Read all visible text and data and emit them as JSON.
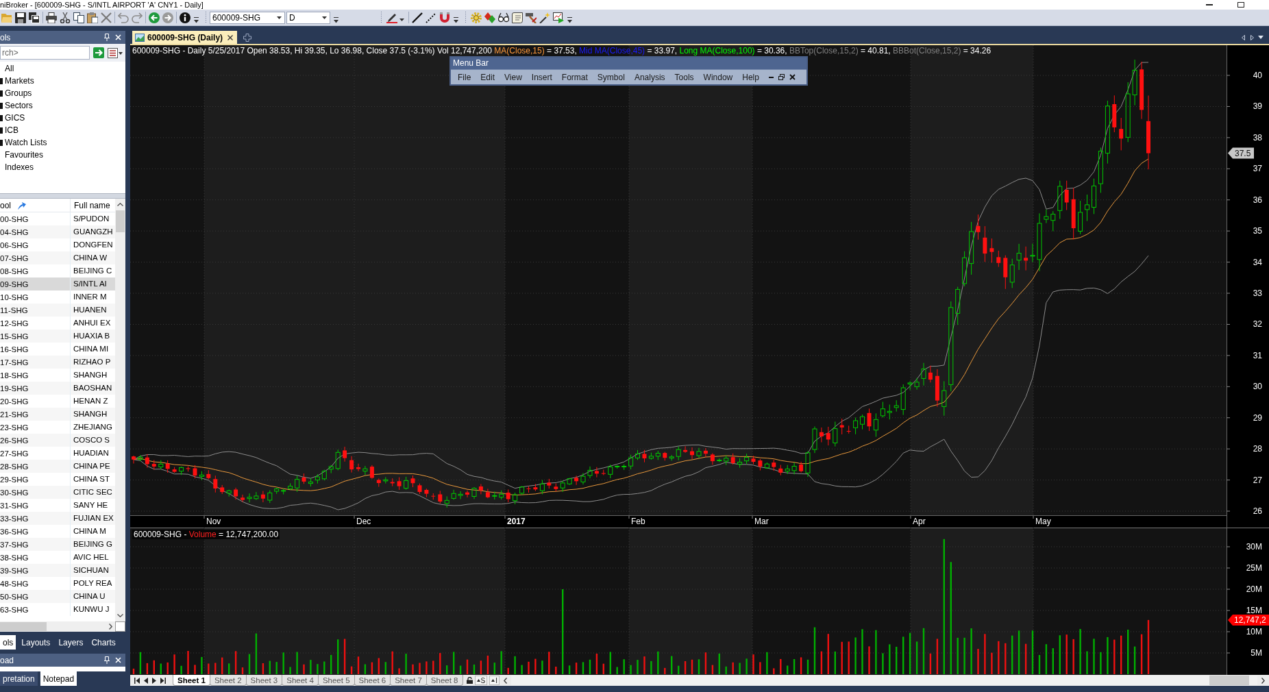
{
  "window": {
    "title": "niBroker - [600009-SHG - S/INTL AIRPORT 'A' CNY1 - Daily]"
  },
  "toolbar": {
    "symbol": "600009-SHG",
    "interval": "D"
  },
  "tools_panel": {
    "title": "ols",
    "search": {
      "placeholder": "rch>"
    },
    "tree": [
      {
        "label": "All",
        "has_expander": false
      },
      {
        "label": "Markets",
        "has_expander": true
      },
      {
        "label": "Groups",
        "has_expander": true
      },
      {
        "label": "Sectors",
        "has_expander": true
      },
      {
        "label": "GICS",
        "has_expander": true
      },
      {
        "label": "ICB",
        "has_expander": true
      },
      {
        "label": "Watch Lists",
        "has_expander": true
      },
      {
        "label": "Favourites",
        "has_expander": false
      },
      {
        "label": "Indexes",
        "has_expander": false
      }
    ]
  },
  "symbol_list": {
    "columns": [
      "ool",
      "Full name"
    ],
    "rows": [
      {
        "symbol": "00-SHG",
        "name": "S/PUDON",
        "selected": false
      },
      {
        "symbol": "04-SHG",
        "name": "GUANGZH",
        "selected": false
      },
      {
        "symbol": "06-SHG",
        "name": "DONGFEN",
        "selected": false
      },
      {
        "symbol": "07-SHG",
        "name": "CHINA W",
        "selected": false
      },
      {
        "symbol": "08-SHG",
        "name": "BEIJING C",
        "selected": false
      },
      {
        "symbol": "09-SHG",
        "name": "S/INTL AI",
        "selected": true
      },
      {
        "symbol": "10-SHG",
        "name": "INNER M",
        "selected": false
      },
      {
        "symbol": "11-SHG",
        "name": "HUANEN",
        "selected": false
      },
      {
        "symbol": "12-SHG",
        "name": "ANHUI EX",
        "selected": false
      },
      {
        "symbol": "15-SHG",
        "name": "HUAXIA B",
        "selected": false
      },
      {
        "symbol": "16-SHG",
        "name": "CHINA MI",
        "selected": false
      },
      {
        "symbol": "17-SHG",
        "name": "RIZHAO P",
        "selected": false
      },
      {
        "symbol": "18-SHG",
        "name": "SHANGH",
        "selected": false
      },
      {
        "symbol": "19-SHG",
        "name": "BAOSHAN",
        "selected": false
      },
      {
        "symbol": "20-SHG",
        "name": "HENAN Z",
        "selected": false
      },
      {
        "symbol": "21-SHG",
        "name": "SHANGH",
        "selected": false
      },
      {
        "symbol": "23-SHG",
        "name": "ZHEJIANG",
        "selected": false
      },
      {
        "symbol": "26-SHG",
        "name": "COSCO S",
        "selected": false
      },
      {
        "symbol": "27-SHG",
        "name": "HUADIAN",
        "selected": false
      },
      {
        "symbol": "28-SHG",
        "name": "CHINA PE",
        "selected": false
      },
      {
        "symbol": "29-SHG",
        "name": "CHINA ST",
        "selected": false
      },
      {
        "symbol": "30-SHG",
        "name": "CITIC SEC",
        "selected": false
      },
      {
        "symbol": "31-SHG",
        "name": "SANY HE",
        "selected": false
      },
      {
        "symbol": "33-SHG",
        "name": "FUJIAN EX",
        "selected": false
      },
      {
        "symbol": "36-SHG",
        "name": "CHINA M",
        "selected": false
      },
      {
        "symbol": "37-SHG",
        "name": "BEIJING G",
        "selected": false
      },
      {
        "symbol": "38-SHG",
        "name": "AVIC HEL",
        "selected": false
      },
      {
        "symbol": "39-SHG",
        "name": "SICHUAN",
        "selected": false
      },
      {
        "symbol": "48-SHG",
        "name": "POLY REA",
        "selected": false
      },
      {
        "symbol": "50-SHG",
        "name": "CHINA U",
        "selected": false
      },
      {
        "symbol": "63-SHG",
        "name": "KUNWU J",
        "selected": false
      }
    ]
  },
  "panel_tabs": [
    {
      "label": "ols",
      "selected": true
    },
    {
      "label": "Layouts",
      "selected": false
    },
    {
      "label": "Layers",
      "selected": false
    },
    {
      "label": "Charts",
      "selected": false
    }
  ],
  "notepad_panel": {
    "title": "oad",
    "tabs": [
      {
        "label": "pretation",
        "selected": false
      },
      {
        "label": "Notepad",
        "selected": true
      }
    ]
  },
  "chart_tab": {
    "label": "600009-SHG (Daily)"
  },
  "price_pane": {
    "legend": [
      {
        "text": "600009-SHG - Daily 5/25/2017 Open 38.53, Hi 39.35, Lo 36.98, Close 37.5 (-3.1%) Vol 12,747,200 ",
        "kind": "plain"
      },
      {
        "text": "MA(Close,15)",
        "kind": "short_ma"
      },
      {
        "text": " = 37.53, ",
        "kind": "plain"
      },
      {
        "text": "Mid MA(Close,45)",
        "kind": "mid_ma"
      },
      {
        "text": " = 33.97, ",
        "kind": "plain"
      },
      {
        "text": "Long MA(Close,100)",
        "kind": "long_ma"
      },
      {
        "text": " = 30.36, ",
        "kind": "plain"
      },
      {
        "text": "BBTop(Close,15,2)",
        "kind": "band"
      },
      {
        "text": " = 40.81, ",
        "kind": "plain"
      },
      {
        "text": "BBBot(Close,15,2)",
        "kind": "band"
      },
      {
        "text": " = 34.26",
        "kind": "plain"
      }
    ],
    "ticks": [
      "40",
      "39",
      "38",
      "37",
      "36",
      "35",
      "34",
      "33",
      "32",
      "31",
      "30",
      "29",
      "28",
      "27",
      "26"
    ],
    "last_price": "37.5"
  },
  "date_axis": [
    {
      "text": "Nov",
      "kind": "month"
    },
    {
      "text": "Dec",
      "kind": "month"
    },
    {
      "text": "2017",
      "kind": "year"
    },
    {
      "text": "Feb",
      "kind": "month"
    },
    {
      "text": "Mar",
      "kind": "month"
    },
    {
      "text": "Apr",
      "kind": "month"
    },
    {
      "text": "May",
      "kind": "month"
    }
  ],
  "volume_pane": {
    "legend": [
      {
        "text": "600009-SHG - ",
        "kind": "plain"
      },
      {
        "text": "Volume",
        "kind": "volume"
      },
      {
        "text": " = 12,747,200.00",
        "kind": "plain"
      }
    ],
    "ticks": [
      "30M",
      "25M",
      "20M",
      "15M",
      "10M",
      "5M"
    ],
    "last_volume": "12,747,2"
  },
  "menu_bar": {
    "title": "Menu Bar",
    "items": [
      "File",
      "Edit",
      "View",
      "Insert",
      "Format",
      "Symbol",
      "Analysis",
      "Tools",
      "Window",
      "Help"
    ]
  },
  "sheet_tabs": [
    {
      "label": "Sheet 1",
      "selected": true
    },
    {
      "label": "Sheet 2",
      "selected": false
    },
    {
      "label": "Sheet 3",
      "selected": false
    },
    {
      "label": "Sheet 4",
      "selected": false
    },
    {
      "label": "Sheet 5",
      "selected": false
    },
    {
      "label": "Sheet 6",
      "selected": false
    },
    {
      "label": "Sheet 7",
      "selected": false
    },
    {
      "label": "Sheet 8",
      "selected": false
    }
  ],
  "sheet_tools": [
    "S",
    "I"
  ]
}
